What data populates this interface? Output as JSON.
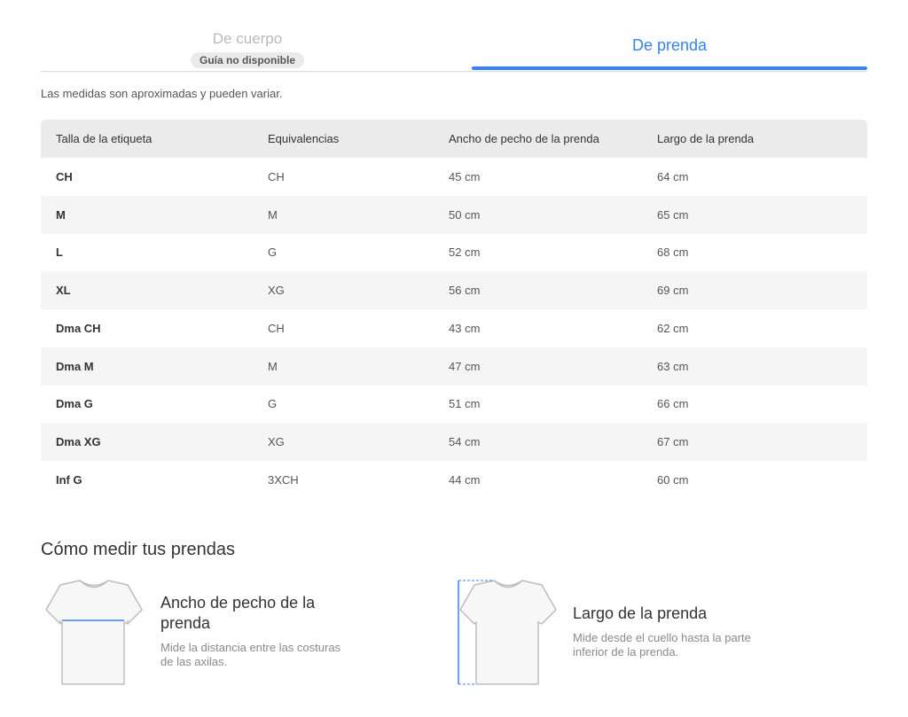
{
  "tabs": {
    "body_label": "De cuerpo",
    "body_badge": "Guía no disponible",
    "garment_label": "De prenda"
  },
  "note": "Las medidas son aproximadas y pueden variar.",
  "table": {
    "headers": [
      "Talla de la etiqueta",
      "Equivalencias",
      "Ancho de pecho de la prenda",
      "Largo de la prenda"
    ],
    "rows": [
      [
        "CH",
        "CH",
        "45 cm",
        "64 cm"
      ],
      [
        "M",
        "M",
        "50 cm",
        "65 cm"
      ],
      [
        "L",
        "G",
        "52 cm",
        "68 cm"
      ],
      [
        "XL",
        "XG",
        "56 cm",
        "69 cm"
      ],
      [
        "Dma CH",
        "CH",
        "43 cm",
        "62 cm"
      ],
      [
        "Dma M",
        "M",
        "47 cm",
        "63 cm"
      ],
      [
        "Dma G",
        "G",
        "51 cm",
        "66 cm"
      ],
      [
        "Dma XG",
        "XG",
        "54 cm",
        "67 cm"
      ],
      [
        "Inf G",
        "3XCH",
        "44 cm",
        "60 cm"
      ]
    ]
  },
  "how_to": {
    "title": "Cómo medir tus prendas",
    "chest": {
      "icon": "tshirt-chest-icon",
      "title": "Ancho de pecho de la prenda",
      "desc": "Mide la distancia entre las costuras de las axilas."
    },
    "length": {
      "icon": "tshirt-length-icon",
      "title": "Largo de la prenda",
      "desc": "Mide desde el cuello hasta la parte inferior de la prenda."
    }
  },
  "colors": {
    "accent": "#3483fa",
    "header_bg": "#ebebeb",
    "alt_row": "#f5f5f5"
  }
}
